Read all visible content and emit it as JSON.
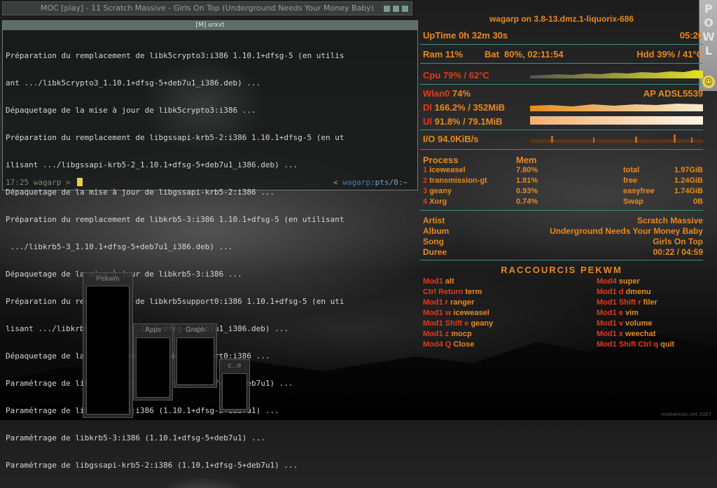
{
  "moc": {
    "title": "MOC [play] - 11 Scratch Massive - Girls On Top (Underground Needs Your Money Baby)"
  },
  "terminal": {
    "title": "[M] urxvt",
    "lines": [
      "Préparation du remplacement de libk5crypto3:i386 1.10.1+dfsg-5 (en utilis",
      "ant .../libk5crypto3_1.10.1+dfsg-5+deb7u1_i386.deb) ...",
      "Dépaquetage de la mise à jour de libk5crypto3:i386 ...",
      "Préparation du remplacement de libgssapi-krb5-2:i386 1.10.1+dfsg-5 (en ut",
      "ilisant .../libgssapi-krb5-2_1.10.1+dfsg-5+deb7u1_i386.deb) ...",
      "Dépaquetage de la mise à jour de libgssapi-krb5-2:i386 ...",
      "Préparation du remplacement de libkrb5-3:i386 1.10.1+dfsg-5 (en utilisant",
      " .../libkrb5-3_1.10.1+dfsg-5+deb7u1_i386.deb) ...",
      "Dépaquetage de la mise à jour de libkrb5-3:i386 ...",
      "Préparation du remplacement de libkrb5support0:i386 1.10.1+dfsg-5 (en uti",
      "lisant .../libkrb5support0_1.10.1+dfsg-5+deb7u1_i386.deb) ...",
      "Dépaquetage de la mise à jour de libkrb5support0:i386 ...",
      "Paramétrage de libkrb5support0:i386 (1.10.1+dfsg-5+deb7u1) ...",
      "Paramétrage de libk5crypto3:i386 (1.10.1+dfsg-5+deb7u1) ...",
      "Paramétrage de libkrb5-3:i386 (1.10.1+dfsg-5+deb7u1) ...",
      "Paramétrage de libgssapi-krb5-2:i386 (1.10.1+dfsg-5+deb7u1) ..."
    ],
    "prompt_time": "17:25",
    "prompt_user": "wagarp",
    "prompt_symbol": ">",
    "right_prompt_open": "<",
    "right_prompt_user": "wagarp",
    "right_prompt_tty": ":pts/0:~"
  },
  "conky": {
    "header": "wagarp on 3.8-13.dmz.1-liquorix-686",
    "uptime_label": "UpTime",
    "uptime_value": "0h 32m 30s",
    "clock": "05:26",
    "ram_label": "Ram",
    "ram_value": "11%",
    "bat_label": "Bat",
    "bat_value": "80%, 02:11:54",
    "hdd_label": "Hdd",
    "hdd_value": "39% / 41°C",
    "cpu_label": "Cpu",
    "cpu_value": "79% / 62°C",
    "wlan_label": "Wlan0",
    "wlan_value": "74%",
    "ap_label": "AP",
    "ap_value": "ADSL5539",
    "dl_label": "Dl",
    "dl_value": "166.2% / 352MiB",
    "ul_label": "Ul",
    "ul_value": "91.8% / 79.1MiB",
    "io_label": "I/O",
    "io_value": "94.0KiB/s",
    "process_label": "Process",
    "mem_label": "Mem",
    "processes": [
      {
        "rank": "1",
        "name": "iceweasel",
        "mem": "7.80%"
      },
      {
        "rank": "2",
        "name": "transmission-gt",
        "mem": "1.81%"
      },
      {
        "rank": "3",
        "name": "geany",
        "mem": "0.93%"
      },
      {
        "rank": "4",
        "name": "Xorg",
        "mem": "0.74%"
      }
    ],
    "memstats": [
      {
        "label": "total",
        "value": "1.97GiB"
      },
      {
        "label": "free",
        "value": "1.24GiB"
      },
      {
        "label": "easyfree",
        "value": "1.74GiB"
      },
      {
        "label": "Swap",
        "value": "0B"
      }
    ],
    "artist_label": "Artist",
    "artist_value": "Scratch Massive",
    "album_label": "Album",
    "album_value": "Underground Needs Your Money Baby",
    "song_label": "Song",
    "song_value": "Girls On Top",
    "duree_label": "Duree",
    "duree_value": "00:22 / 04:59",
    "shortcuts_title": "RACCOURCIS PEKWM",
    "shortcuts_left": [
      {
        "key": "Mod1",
        "action": "alt"
      },
      {
        "key": "Ctrl Return",
        "action": "term"
      },
      {
        "key": "Mod1 r",
        "action": "ranger"
      },
      {
        "key": "Mod1 w",
        "action": "iceweasel"
      },
      {
        "key": "Mod1 Shift e",
        "action": "geany"
      },
      {
        "key": "Mod1 z",
        "action": "mocp"
      },
      {
        "key": "Mod4 Q",
        "action": "Close"
      }
    ],
    "shortcuts_right": [
      {
        "key": "Mod4",
        "action": "super"
      },
      {
        "key": "Mod1 d",
        "action": "dmenu"
      },
      {
        "key": "Mod1 Shift r",
        "action": "filer"
      },
      {
        "key": "Mod1 e",
        "action": "vim"
      },
      {
        "key": "Mod1 v",
        "action": "volume"
      },
      {
        "key": "Mod1 x",
        "action": "weechat"
      },
      {
        "key": "Mod1 Shift Ctrl q",
        "action": "quit"
      }
    ]
  },
  "side_panel": {
    "letters": [
      "P",
      "O",
      "W",
      "L"
    ],
    "icon": "smiley-icon"
  },
  "pager": {
    "workspaces": [
      "Pekwm",
      "Apps",
      "Graph",
      "c...e"
    ]
  },
  "credit": "mattwilcox.net 2007",
  "colors": {
    "accent": "#e8891e",
    "red": "#e23a1e",
    "separator": "#3d8b8d"
  }
}
